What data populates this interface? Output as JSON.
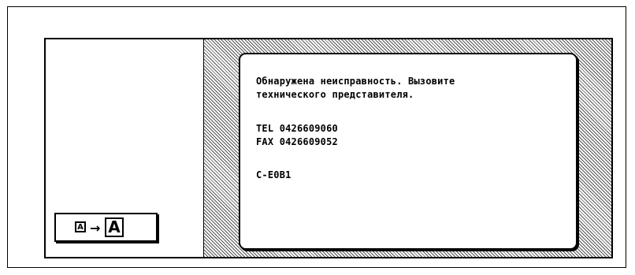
{
  "dialog": {
    "message_line1": "Обнаружена неисправность. Вызовите",
    "message_line2": "технического представителя.",
    "tel": "TEL 0426609060",
    "fax": "FAX 0426609052",
    "error_code": "C-E0B1"
  },
  "controls": {
    "enlarge_small_glyph": "A",
    "enlarge_arrow_glyph": "→",
    "enlarge_big_glyph": "A"
  }
}
